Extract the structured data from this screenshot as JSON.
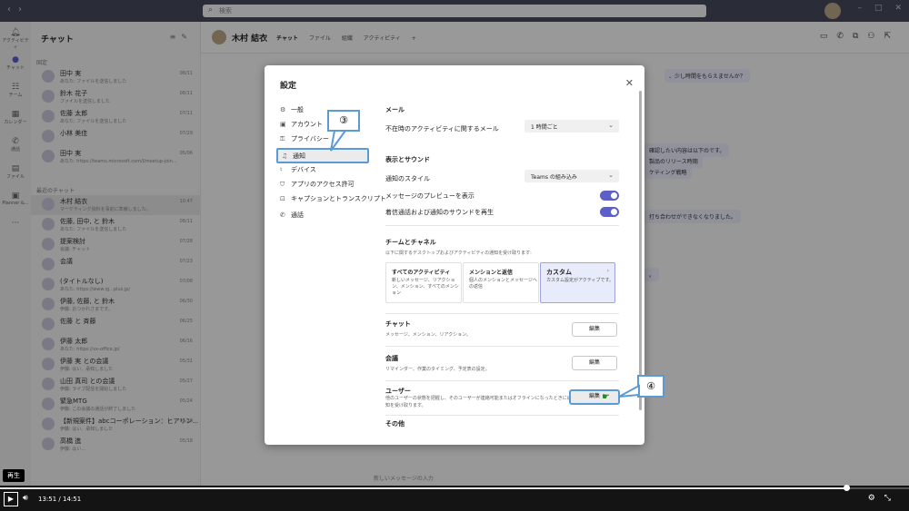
{
  "titlebar": {
    "search_placeholder": "検索",
    "back_icon": "chevron-left-icon",
    "forward_icon": "chevron-right-icon"
  },
  "rail": [
    {
      "label": "アクティビティ",
      "icon": "bell-icon"
    },
    {
      "label": "チャット",
      "icon": "chat-icon"
    },
    {
      "label": "チーム",
      "icon": "teams-icon"
    },
    {
      "label": "カレンダー",
      "icon": "calendar-icon"
    },
    {
      "label": "通話",
      "icon": "phone-icon"
    },
    {
      "label": "ファイル",
      "icon": "file-icon"
    },
    {
      "label": "Planner &...",
      "icon": "planner-icon"
    }
  ],
  "chatlist": {
    "title": "チャット",
    "pinned_label": "固定",
    "recent_label": "最近のチャット",
    "items": [
      {
        "name": "田中 実",
        "preview": "あなた: ファイルを送信しました",
        "date": "08/11"
      },
      {
        "name": "鈴木 花子",
        "preview": "ファイルを送信しました",
        "date": "08/11"
      },
      {
        "name": "佐藤 太郎",
        "preview": "あなた: ファイルを送信しました",
        "date": "07/11"
      },
      {
        "name": "小林 美佳",
        "preview": "",
        "date": "07/29"
      },
      {
        "name": "田中 実",
        "preview": "あなた: https://teams.microsoft.com/l/meetup-join...",
        "date": "05/06"
      },
      {
        "name": "木村 結衣",
        "preview": "マーケティング資料を事前に準備しました。",
        "date": "10:47"
      },
      {
        "name": "佐藤, 田中, と 鈴木",
        "preview": "あなた: ファイルを送信しました",
        "date": "08/11"
      },
      {
        "name": "提案検討",
        "preview": "会議: チャット",
        "date": "07/28"
      },
      {
        "name": "会議",
        "preview": "",
        "date": "07/23"
      },
      {
        "name": "(タイトルなし)",
        "preview": "あなた: https://www.ig...plus.jp/",
        "date": "07/08"
      },
      {
        "name": "伊藤, 佐藤, と 鈴木",
        "preview": "伊藤: おつかれさまです。",
        "date": "06/30"
      },
      {
        "name": "佐藤 と 斉藤",
        "preview": "",
        "date": "06/25"
      },
      {
        "name": "伊藤 太郎",
        "preview": "あなた: https://xx-office.jp/",
        "date": "06/16"
      },
      {
        "name": "伊藤 実 との会議",
        "preview": "伊藤: はい、承知しました",
        "date": "05/31"
      },
      {
        "name": "山田 真司 との会議",
        "preview": "伊藤: ライブ配信を開始しました",
        "date": "05/27"
      },
      {
        "name": "緊急MTG",
        "preview": "伊藤: この会議の通話が終了しました",
        "date": "05/24"
      },
      {
        "name": "【新規案件】abcコーポレーション：ヒアリン...",
        "preview": "伊藤: はい、承知しました",
        "date": "05/20"
      },
      {
        "name": "高橋 進",
        "preview": "伊藤: はい...",
        "date": "05/18"
      }
    ]
  },
  "conversation": {
    "name": "木村 結衣",
    "tabs": [
      "チャット",
      "ファイル",
      "組織",
      "アクティビティ"
    ],
    "add_tab": "+",
    "bubbles": [
      "、少し時間をもらえませんか？",
      "確認したい内容は以下のです。",
      "製品のリリース時期",
      "ケティング戦略",
      "打ち合わせができなくなりました。",
      "。"
    ],
    "composer_placeholder": "新しいメッセージの入力"
  },
  "dialog": {
    "title": "設定",
    "menu": [
      {
        "label": "一般",
        "icon": "gear-icon"
      },
      {
        "label": "アカウント",
        "icon": "account-icon"
      },
      {
        "label": "プライバシー",
        "icon": "lock-icon"
      },
      {
        "label": "通知",
        "icon": "bell-icon",
        "active": true
      },
      {
        "label": "デバイス",
        "icon": "headset-icon"
      },
      {
        "label": "アプリのアクセス許可",
        "icon": "shield-icon"
      },
      {
        "label": "キャプションとトランスクリプト",
        "icon": "cc-icon"
      },
      {
        "label": "通話",
        "icon": "phone-icon"
      }
    ],
    "mail": {
      "heading": "メール",
      "label": "不在時のアクティビティに関するメール",
      "value": "1 時間ごと"
    },
    "display": {
      "heading": "表示とサウンド",
      "style_label": "通知のスタイル",
      "style_value": "Teams の組み込み",
      "preview_label": "メッセージのプレビューを表示",
      "preview_on": true,
      "sound_label": "着信通話および通知のサウンドを再生",
      "sound_on": true
    },
    "teams": {
      "heading": "チームとチャネル",
      "desc": "以下に関するデスクトップおよびアクティビティの通知を受け取ります:",
      "cards": [
        {
          "title": "すべてのアクティビティ",
          "desc": "新しいメッセージ、リアクション、メンション、すべてのメンション"
        },
        {
          "title": "メンションと返信",
          "desc": "個人のメンションとメッセージへの返信"
        },
        {
          "title": "カスタム",
          "desc": "カスタム設定がアクティブです。",
          "selected": true
        }
      ]
    },
    "chat": {
      "heading": "チャット",
      "desc": "メッセージ、メンション、リアクション。",
      "button": "編集"
    },
    "meeting": {
      "heading": "会議",
      "desc": "リマインダー、作業のタイミング、予定表の設定。",
      "button": "編集"
    },
    "user": {
      "heading": "ユーザー",
      "desc": "他のユーザーの状態を把握し、そのユーザーが連絡可能またはオフラインになったときに通知を受け取ります。",
      "button": "編集"
    },
    "other": {
      "heading": "その他"
    }
  },
  "callouts": {
    "step3": "③",
    "step4": "④"
  },
  "player": {
    "tooltip": "再生",
    "current": "13:51",
    "separator": "/",
    "total": "14:51",
    "progress": 0.931
  }
}
